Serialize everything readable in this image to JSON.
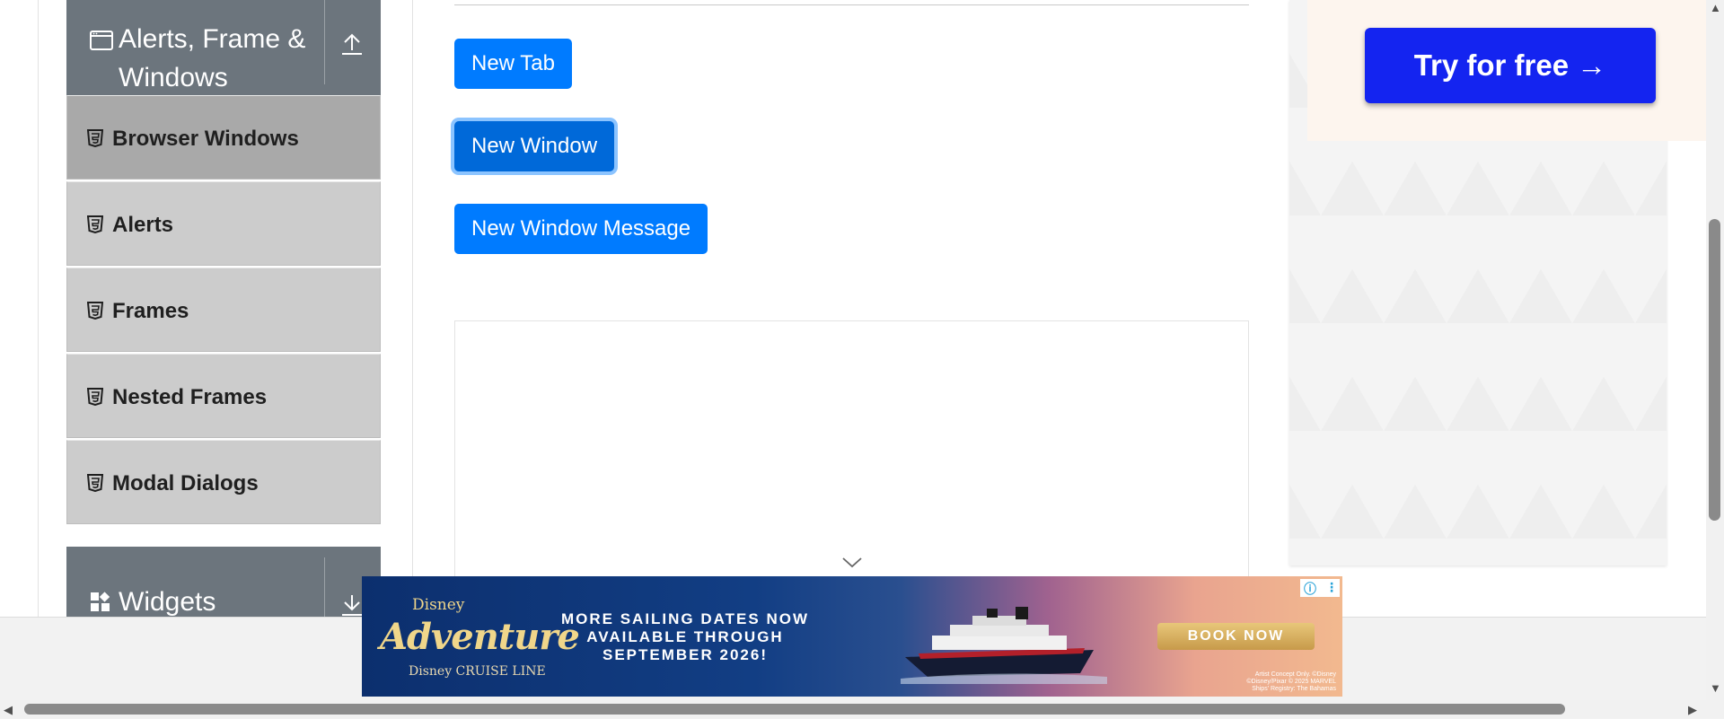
{
  "sidebar": {
    "group_alerts": {
      "label": "Alerts, Frame & Windows",
      "icon": "window-icon",
      "toggle_icon": "upload-arrow-icon"
    },
    "items": [
      {
        "label": "Browser Windows",
        "icon": "html5-icon",
        "active": true
      },
      {
        "label": "Alerts",
        "icon": "html5-icon",
        "active": false
      },
      {
        "label": "Frames",
        "icon": "html5-icon",
        "active": false
      },
      {
        "label": "Nested Frames",
        "icon": "html5-icon",
        "active": false
      },
      {
        "label": "Modal Dialogs",
        "icon": "html5-icon",
        "active": false
      }
    ],
    "group_widgets": {
      "label": "Widgets",
      "icon": "widgets-icon",
      "toggle_icon": "download-arrow-icon"
    }
  },
  "main": {
    "buttons": {
      "new_tab": "New Tab",
      "new_window": "New Window",
      "new_window_message": "New Window Message"
    }
  },
  "ad_right": {
    "cta": "Try for free →"
  },
  "banner": {
    "brand_small": "Disney",
    "brand": "Adventure",
    "line": "Disney CRUISE LINE",
    "headline": "MORE SAILING DATES NOW AVAILABLE THROUGH SEPTEMBER 2026!",
    "cta": "BOOK NOW",
    "fine_print": "Artist Concept Only. ©Disney ©Disney/Pixar © 2025 MARVEL Ships' Registry: The Bahamas"
  },
  "colors": {
    "primary": "#007bff",
    "sidebar_header": "#6c757d",
    "menu_item": "#cccccc",
    "menu_item_active": "#a9a9a9",
    "ad_cta": "#1424f0"
  }
}
